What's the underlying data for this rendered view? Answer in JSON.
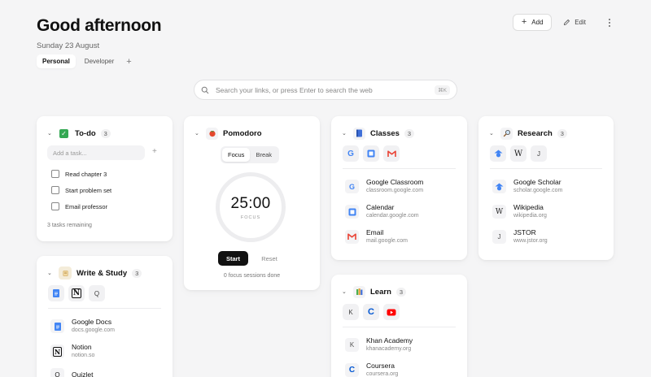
{
  "header": {
    "greeting": "Good afternoon",
    "date": "Sunday 23 August",
    "tabs": [
      {
        "label": "Personal",
        "active": true
      },
      {
        "label": "Developer",
        "active": false
      }
    ],
    "add_tab_icon": "+",
    "add_label": "Add",
    "add_icon": "+",
    "edit_label": "Edit"
  },
  "search": {
    "placeholder": "Search your links, or press Enter to search the web",
    "shortcut": "⌘K"
  },
  "todo": {
    "title": "To-do",
    "count": "3",
    "input_placeholder": "Add a task...",
    "add_icon": "+",
    "tasks": [
      {
        "label": "Read chapter 3",
        "done": false
      },
      {
        "label": "Start problem set",
        "done": false
      },
      {
        "label": "Email professor",
        "done": false
      }
    ],
    "remaining": "3 tasks remaining"
  },
  "pomodoro": {
    "title": "Pomodoro",
    "modes": [
      "Focus",
      "Break"
    ],
    "active_mode": "Focus",
    "time": "25:00",
    "phase": "FOCUS",
    "start_label": "Start",
    "reset_label": "Reset",
    "sessions": "0 focus sessions done"
  },
  "classes": {
    "title": "Classes",
    "count": "3",
    "chips": [
      "G",
      "",
      ""
    ],
    "links": [
      {
        "name": "Google Classroom",
        "url": "classroom.google.com",
        "icon": "G"
      },
      {
        "name": "Calendar",
        "url": "calendar.google.com",
        "icon": ""
      },
      {
        "name": "Email",
        "url": "mail.google.com",
        "icon": ""
      }
    ]
  },
  "research": {
    "title": "Research",
    "count": "3",
    "chips": [
      "",
      "W",
      "J"
    ],
    "links": [
      {
        "name": "Google Scholar",
        "url": "scholar.google.com",
        "icon": ""
      },
      {
        "name": "Wikipedia",
        "url": "wikipedia.org",
        "icon": "W"
      },
      {
        "name": "JSTOR",
        "url": "www.jstor.org",
        "icon": "J"
      }
    ]
  },
  "write_study": {
    "title": "Write & Study",
    "count": "3",
    "chips": [
      "",
      "N",
      "Q"
    ],
    "links": [
      {
        "name": "Google Docs",
        "url": "docs.google.com",
        "icon": ""
      },
      {
        "name": "Notion",
        "url": "notion.so",
        "icon": "N"
      },
      {
        "name": "Quizlet",
        "url": "",
        "icon": "Q"
      }
    ]
  },
  "learn": {
    "title": "Learn",
    "count": "3",
    "chips": [
      "K",
      "C",
      ""
    ],
    "links": [
      {
        "name": "Khan Academy",
        "url": "khanacademy.org",
        "icon": "K"
      },
      {
        "name": "Coursera",
        "url": "coursera.org",
        "icon": "C"
      }
    ]
  },
  "colors": {
    "background": "#f5f5f6",
    "primary_button": "#111111",
    "google_blue": "#4285f4",
    "gmail_red": "#ea4335",
    "youtube_red": "#ff0000",
    "coursera_blue": "#0056d2",
    "todo_green": "#34a853"
  }
}
